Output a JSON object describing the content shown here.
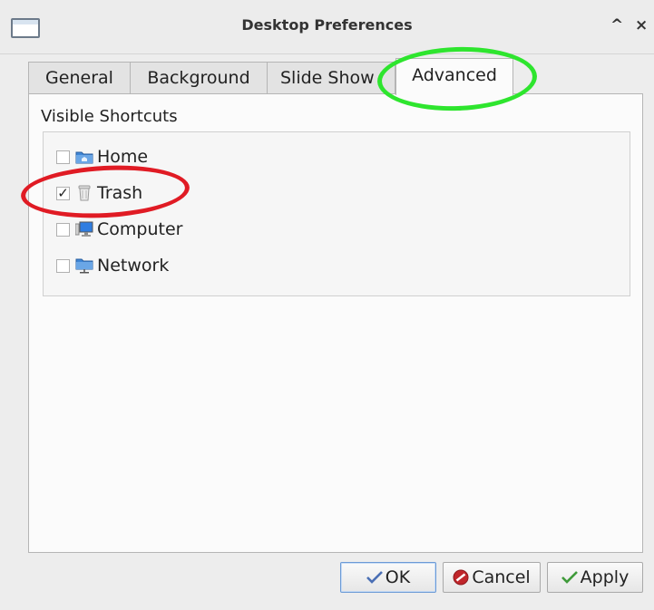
{
  "window": {
    "title": "Desktop Preferences",
    "shade_glyph": "^",
    "close_glyph": "×"
  },
  "tabs": [
    {
      "label": "General",
      "active": false
    },
    {
      "label": "Background",
      "active": false
    },
    {
      "label": "Slide Show",
      "active": false
    },
    {
      "label": "Advanced",
      "active": true
    }
  ],
  "advanced": {
    "group_label": "Visible Shortcuts",
    "shortcuts": [
      {
        "label": "Home",
        "checked": false,
        "icon": "home-folder-icon"
      },
      {
        "label": "Trash",
        "checked": true,
        "icon": "trash-icon"
      },
      {
        "label": "Computer",
        "checked": false,
        "icon": "computer-icon"
      },
      {
        "label": "Network",
        "checked": false,
        "icon": "network-folder-icon"
      }
    ]
  },
  "buttons": {
    "ok": {
      "label": "OK",
      "icon": "checkmark-icon"
    },
    "cancel": {
      "label": "Cancel",
      "icon": "cancel-icon"
    },
    "apply": {
      "label": "Apply",
      "icon": "checkmark-icon"
    }
  },
  "colors": {
    "annotation_red": "#e01b24",
    "annotation_green": "#2ee52e",
    "focus_blue": "#6b9ad6"
  }
}
